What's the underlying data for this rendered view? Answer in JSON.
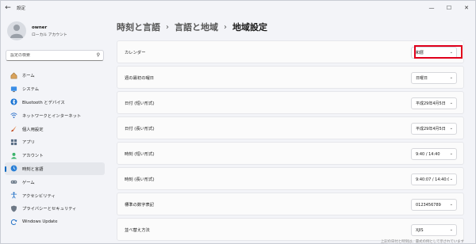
{
  "window": {
    "app_title": "設定",
    "back_icon": "back-arrow-icon",
    "controls": [
      "minimize-icon",
      "maximize-icon",
      "close-icon"
    ]
  },
  "profile": {
    "name": "owner",
    "account_type": "ローカル アカウント"
  },
  "search": {
    "placeholder": "設定の検索",
    "icon": "search-icon"
  },
  "nav": {
    "items": [
      {
        "label": "ホーム",
        "icon": "home-icon",
        "selected": false
      },
      {
        "label": "システム",
        "icon": "system-icon",
        "selected": false
      },
      {
        "label": "Bluetooth とデバイス",
        "icon": "bluetooth-icon",
        "selected": false
      },
      {
        "label": "ネットワークとインターネット",
        "icon": "wifi-icon",
        "selected": false
      },
      {
        "label": "個人用設定",
        "icon": "brush-icon",
        "selected": false
      },
      {
        "label": "アプリ",
        "icon": "apps-icon",
        "selected": false
      },
      {
        "label": "アカウント",
        "icon": "account-icon",
        "selected": false
      },
      {
        "label": "時刻と言語",
        "icon": "time-language-icon",
        "selected": true
      },
      {
        "label": "ゲーム",
        "icon": "gaming-icon",
        "selected": false
      },
      {
        "label": "アクセシビリティ",
        "icon": "accessibility-icon",
        "selected": false
      },
      {
        "label": "プライバシーとセキュリティ",
        "icon": "shield-icon",
        "selected": false
      },
      {
        "label": "Windows Update",
        "icon": "update-icon",
        "selected": false
      }
    ]
  },
  "breadcrumb": {
    "items": [
      "時刻と言語",
      "言語と地域",
      "地域設定"
    ],
    "separator": "›"
  },
  "settings": {
    "rows": [
      {
        "label": "カレンダー",
        "value": "和暦"
      },
      {
        "label": "週の最初の曜日",
        "value": "日曜日"
      },
      {
        "label": "日付 (短い形式)",
        "value": "平成29年4月5日"
      },
      {
        "label": "日付 (長い形式)",
        "value": "平成29年4月5日"
      },
      {
        "label": "時刻 (短い形式)",
        "value": "9:40 / 14:40"
      },
      {
        "label": "時刻 (長い形式)",
        "value": "9:40:07 / 14:40:07"
      },
      {
        "label": "標準の数字表記",
        "value": "0123456789"
      },
      {
        "label": "並べ替え方法",
        "value": "XJIS"
      }
    ]
  },
  "footnote": "上記の日付と時刻は、書式の例として示されています",
  "colors": {
    "accent": "#0067c0",
    "highlight": "#e0001b",
    "window_bg": "#f3f4f8",
    "card_bg": "#fbfbfb"
  }
}
